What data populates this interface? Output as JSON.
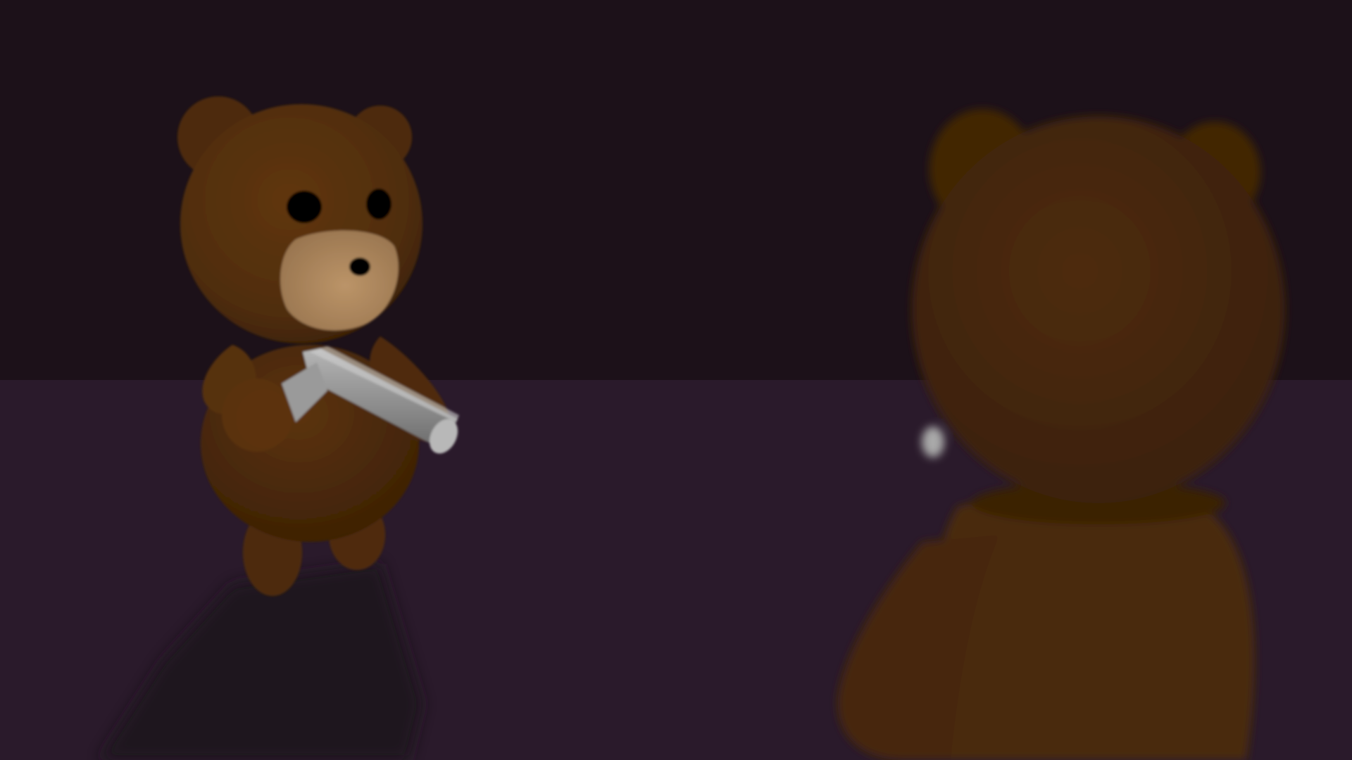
{
  "scene": {
    "colors": {
      "wall": "#1c1119",
      "floor": "#2a1a2b",
      "shadow": "#1f141f",
      "fur": "#5a3209",
      "fur_dark": "#3f2306",
      "fur_near": "#4c2a09",
      "muzzle": "#b08a62",
      "eye": "#050303",
      "weapon": "#8f8f8f",
      "weapon_light": "#c9c9c9"
    },
    "characters": [
      {
        "role": "enemy-bear",
        "holding": "pistol",
        "icon": "teddy-bear-icon"
      },
      {
        "role": "player-bear",
        "view": "over-the-shoulder",
        "focus": "blurred",
        "icon": "teddy-bear-back-icon"
      }
    ]
  }
}
